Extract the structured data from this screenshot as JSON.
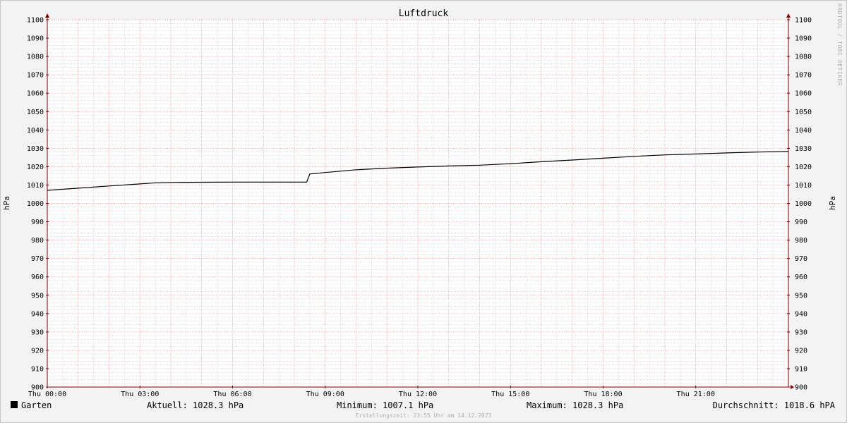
{
  "chart_data": {
    "type": "line",
    "title": "Luftdruck",
    "ylabel": "hPa",
    "ylabel_right": "hPa",
    "ylim": [
      900,
      1100
    ],
    "xlim": [
      0,
      24
    ],
    "x_unit": "hours",
    "grid": true,
    "yticks": [
      900,
      910,
      920,
      930,
      940,
      950,
      960,
      970,
      980,
      990,
      1000,
      1010,
      1020,
      1030,
      1040,
      1050,
      1060,
      1070,
      1080,
      1090,
      1100
    ],
    "xticks": [
      {
        "x": 0,
        "label": "Thu 00:00"
      },
      {
        "x": 3,
        "label": "Thu 03:00"
      },
      {
        "x": 6,
        "label": "Thu 06:00"
      },
      {
        "x": 9,
        "label": "Thu 09:00"
      },
      {
        "x": 12,
        "label": "Thu 12:00"
      },
      {
        "x": 15,
        "label": "Thu 15:00"
      },
      {
        "x": 18,
        "label": "Thu 18:00"
      },
      {
        "x": 21,
        "label": "Thu 21:00"
      }
    ],
    "series": [
      {
        "name": "Garten",
        "color": "#000000",
        "points": [
          [
            0,
            1007.1
          ],
          [
            1,
            1008.3
          ],
          [
            2,
            1009.5
          ],
          [
            3,
            1010.6
          ],
          [
            3.5,
            1011.2
          ],
          [
            4,
            1011.4
          ],
          [
            5,
            1011.5
          ],
          [
            6,
            1011.6
          ],
          [
            7,
            1011.6
          ],
          [
            8,
            1011.6
          ],
          [
            8.4,
            1011.6
          ],
          [
            8.5,
            1016.0
          ],
          [
            9,
            1016.8
          ],
          [
            10,
            1018.3
          ],
          [
            11,
            1019.2
          ],
          [
            12,
            1019.8
          ],
          [
            13,
            1020.4
          ],
          [
            14,
            1020.8
          ],
          [
            15,
            1021.6
          ],
          [
            16,
            1022.7
          ],
          [
            17,
            1023.6
          ],
          [
            18,
            1024.6
          ],
          [
            19,
            1025.6
          ],
          [
            20,
            1026.4
          ],
          [
            21,
            1026.9
          ],
          [
            22,
            1027.5
          ],
          [
            23,
            1028.0
          ],
          [
            24,
            1028.3
          ]
        ]
      }
    ]
  },
  "legend": {
    "series_name": "Garten",
    "current": "Aktuell: 1028.3 hPa",
    "minimum": "Minimum: 1007.1 hPa",
    "maximum": "Maximum: 1028.3 hPa",
    "average": "Durchschnitt: 1018.6 hPA"
  },
  "watermark": "RRDTOOL / TOBI OETIKER",
  "created": "Erstellungszeit: 23:55 Uhr am 14.12.2023",
  "colors": {
    "background": "#f3f3f3",
    "plot_background": "#ffffff",
    "major_grid": "#e58c8c",
    "minor_grid": "#cfcfcf",
    "axis": "#800000",
    "line": "#000000"
  }
}
